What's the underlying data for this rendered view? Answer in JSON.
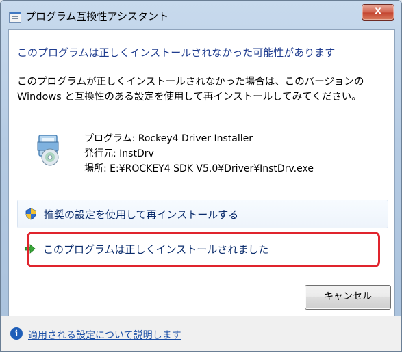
{
  "window": {
    "title": "プログラム互換性アシスタント",
    "close_label": "X"
  },
  "main": {
    "heading": "このプログラムは正しくインストールされなかった可能性があります",
    "description": "このプログラムが正しくインストールされなかった場合は、このバージョンの Windows と互換性のある設定を使用して再インストールしてみてください。",
    "program_info": {
      "program": "プログラム: Rockey4 Driver Installer",
      "publisher": "発行元: InstDrv",
      "location": "場所: E:¥ROCKEY4 SDK V5.0¥Driver¥InstDrv.exe"
    },
    "options": [
      {
        "label": "推奨の設定を使用して再インストールする",
        "icon": "shield-icon"
      },
      {
        "label": "このプログラムは正しくインストールされました",
        "icon": "green-arrow-icon"
      }
    ],
    "cancel_label": "キャンセル"
  },
  "footer": {
    "link_text": "適用される設定について説明します",
    "icon": "info-icon"
  },
  "colors": {
    "heading": "#1f3c8f",
    "highlight": "#e0242d",
    "link": "#1a4ea6"
  }
}
